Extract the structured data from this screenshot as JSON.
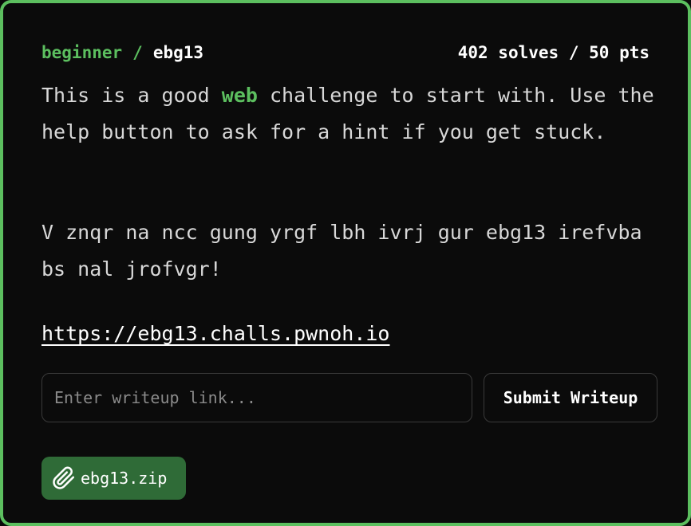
{
  "challenge": {
    "category": "beginner",
    "separator": "/",
    "name": "ebg13",
    "solves": "402 solves",
    "stats_separator": "/",
    "points": "50 pts"
  },
  "description": {
    "part1": "This is a good ",
    "highlight": "web",
    "part2": " challenge to start with. Use the help button to ask for a hint if you get stuck.",
    "rot13": "V znqr na ncc gung yrgf lbh ivrj gur ebg13 irefvba bs nal jrofvgr!"
  },
  "link": "https://ebg13.challs.pwnoh.io",
  "writeup": {
    "placeholder": "Enter writeup link...",
    "submit_label": "Submit Writeup"
  },
  "attachment": {
    "icon": "paperclip-icon",
    "filename": "ebg13.zip"
  },
  "colors": {
    "accent": "#5cbf5f",
    "attachment_bg": "#2f6b37",
    "background": "#0b0b0b"
  }
}
